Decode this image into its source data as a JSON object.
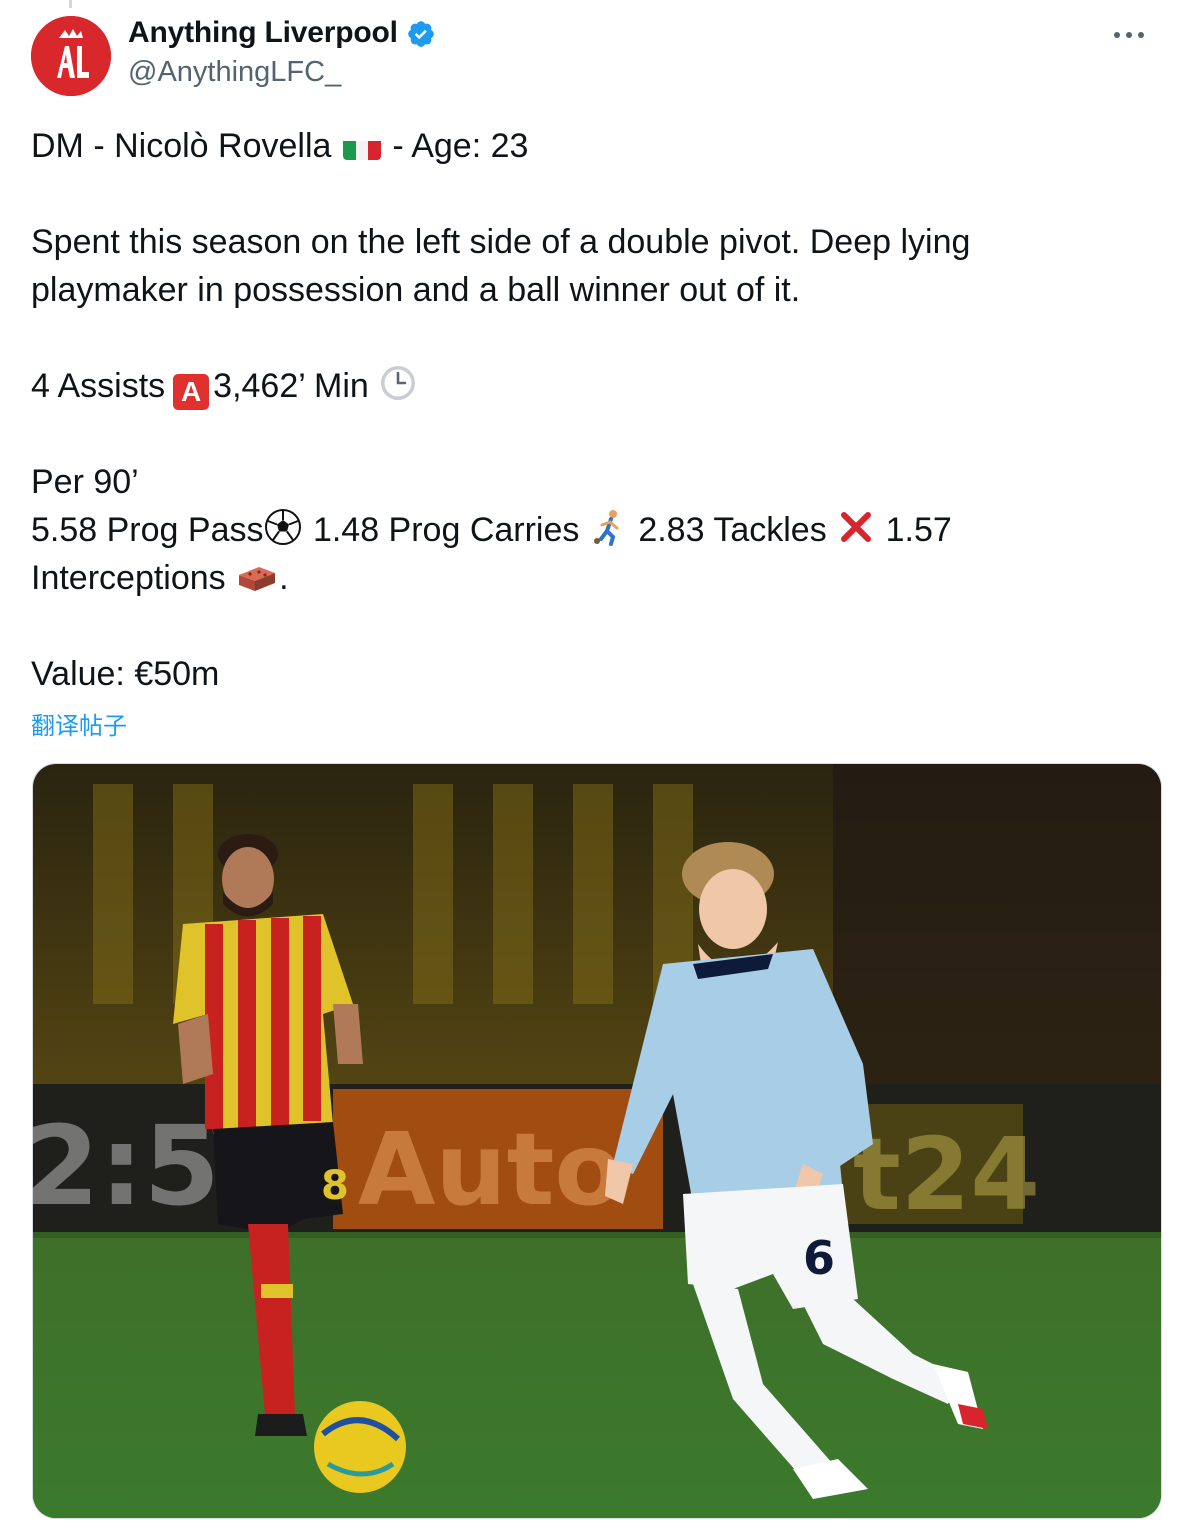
{
  "account": {
    "display_name": "Anything Liverpool",
    "handle": "@AnythingLFC_",
    "verified": true,
    "avatar_color": "#d8282b"
  },
  "tweet": {
    "line1_prefix": "DM - Nicolò Rovella",
    "line1_suffix": "- Age: 23",
    "para1_line1": "Spent this season on the left side of a double pivot. Deep lying",
    "para1_line2": "playmaker in possession and a ball winner out of it.",
    "assists": "4 Assists",
    "minutes": "3,462’ Min",
    "per90_heading": "Per 90’",
    "prog_pass": "5.58 Prog Pass",
    "prog_carries": "1.48 Prog Carries",
    "tackles": "2.83 Tackles",
    "interceptions_num": "1.57",
    "interceptions_label": "Interceptions",
    "interceptions_end": ".",
    "value": "Value: €50m"
  },
  "translate_link": "翻译帖子",
  "media": {
    "description_icon": "football-photo",
    "jersey_number_front": "6",
    "jersey_number_back": "8",
    "board_text_left": "2:55",
    "board_text_mid": "Auto",
    "board_text_right": "t24"
  },
  "icons": [
    "verified-badge-icon",
    "more-icon",
    "italy-flag-icon",
    "a-button-icon",
    "clock-icon",
    "soccer-ball-icon",
    "person-running-icon",
    "cross-mark-icon",
    "brick-icon"
  ]
}
